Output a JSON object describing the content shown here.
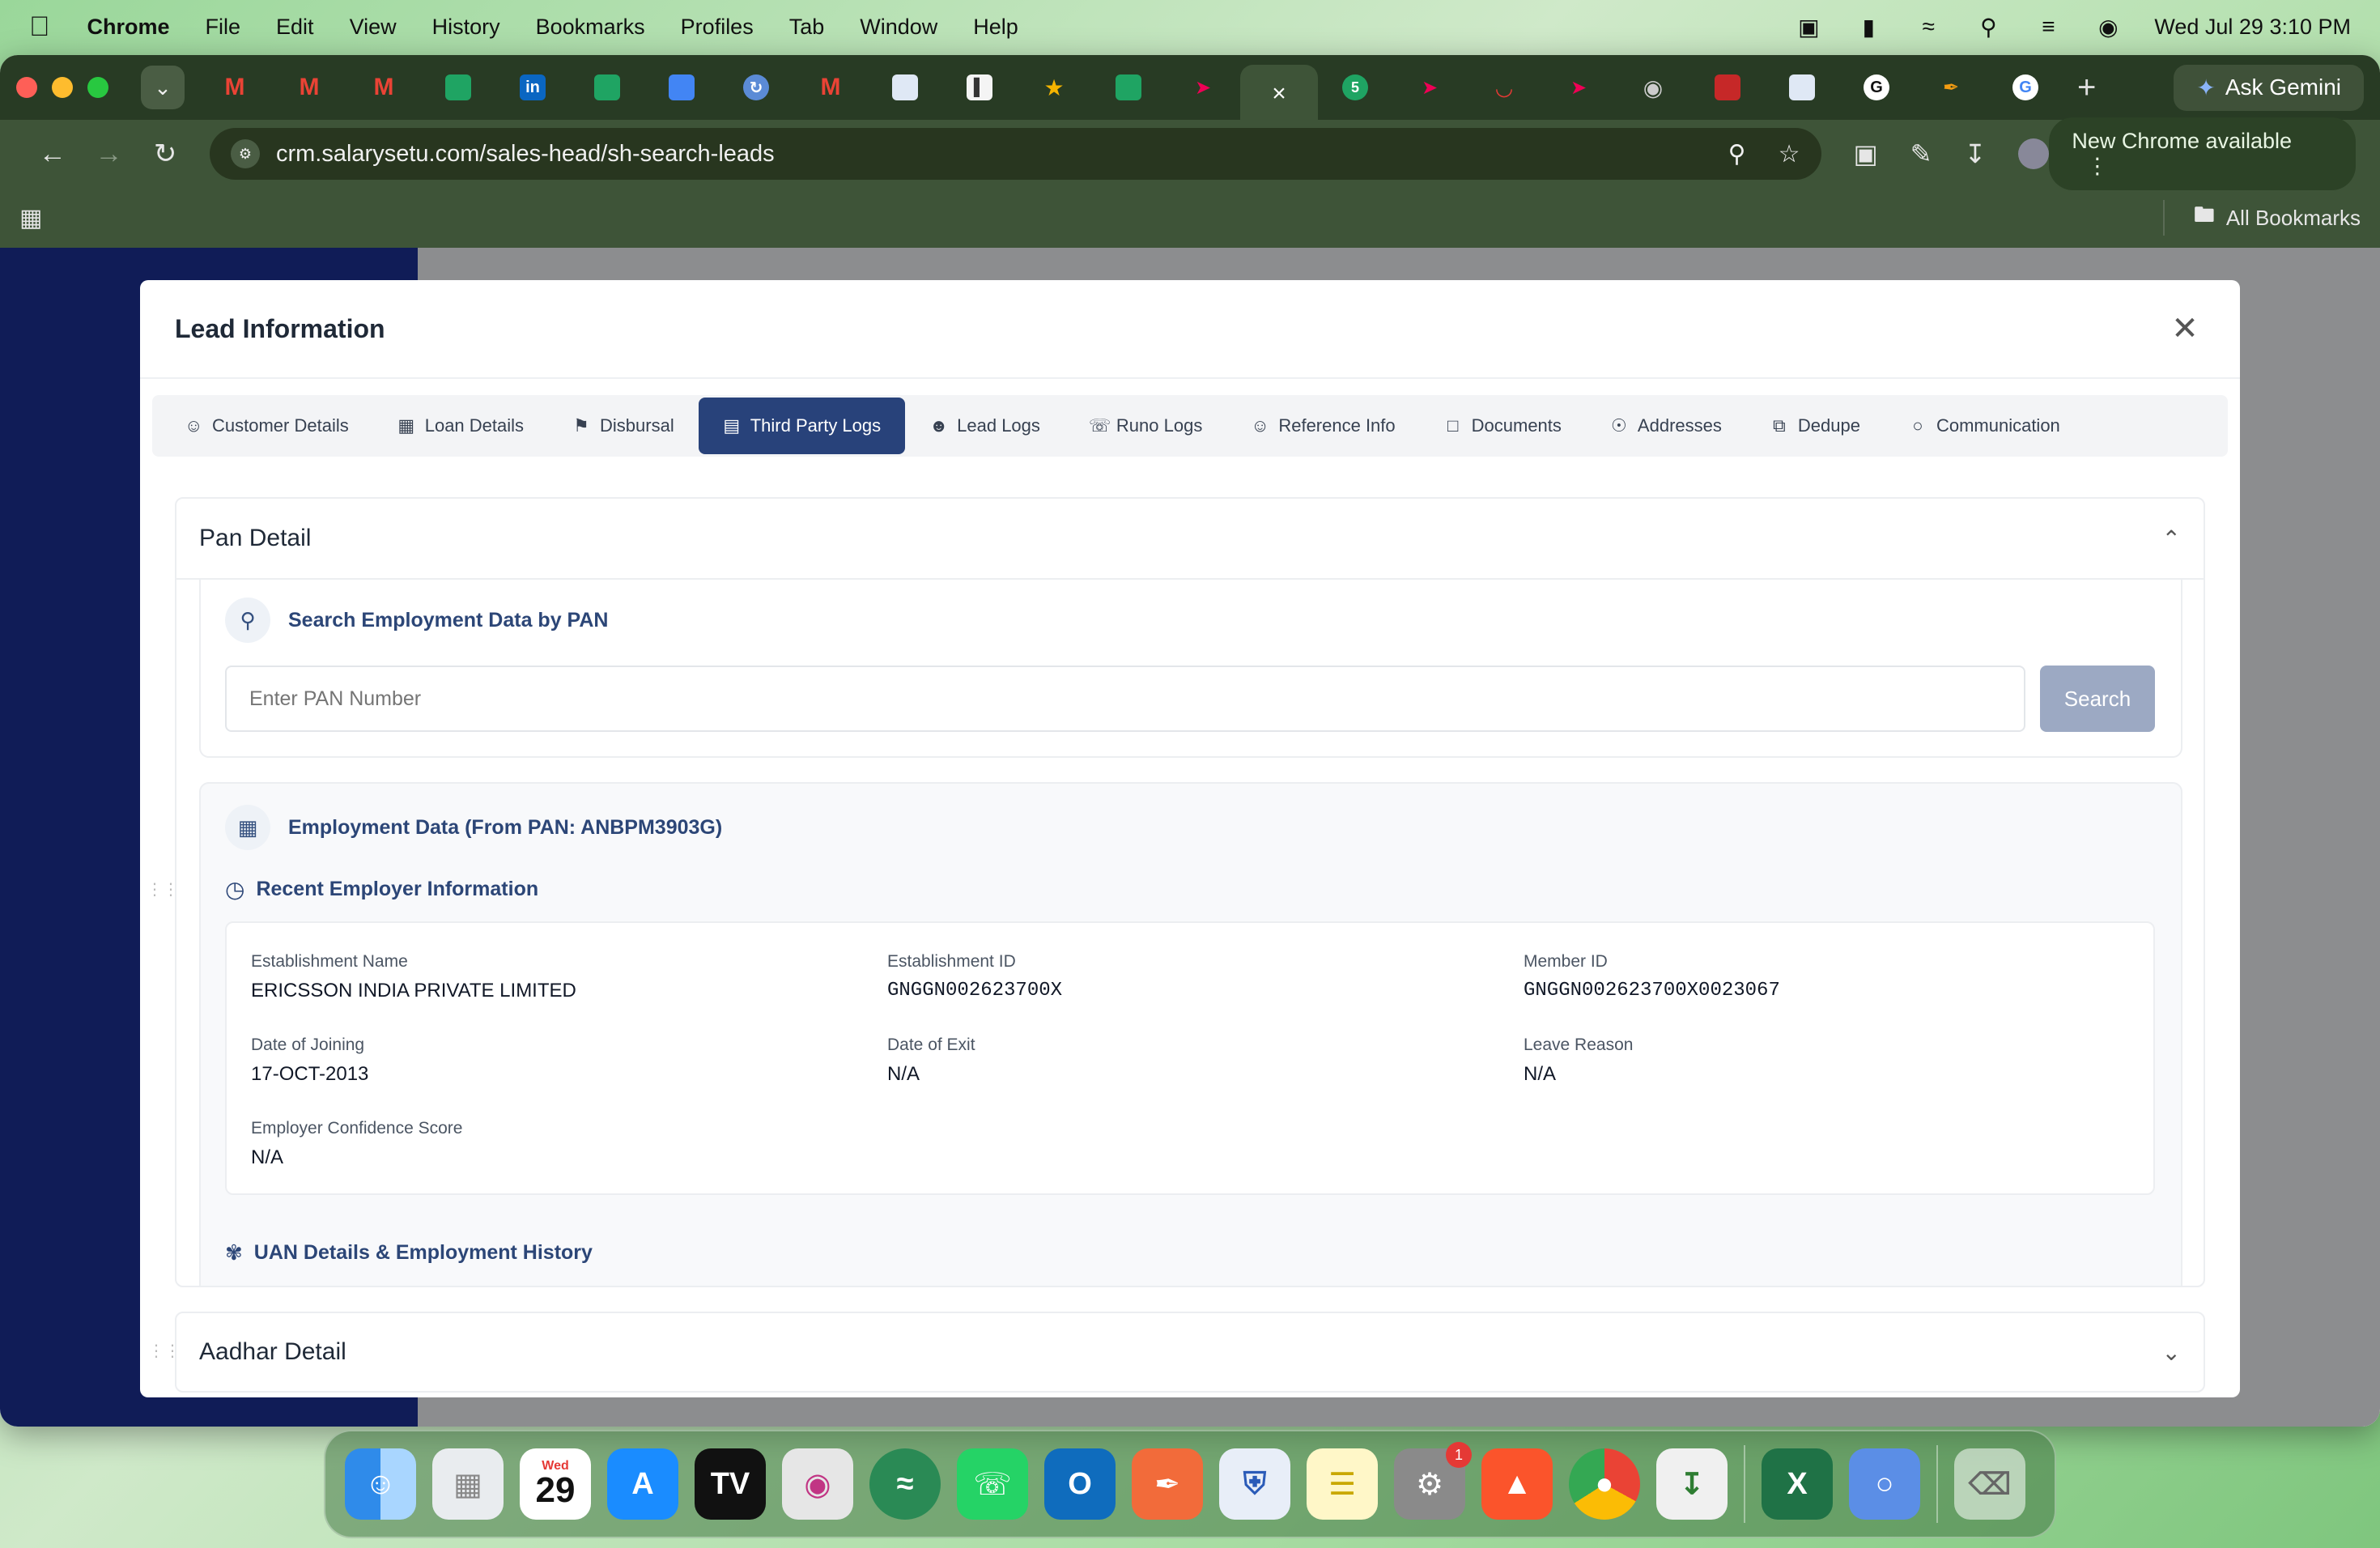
{
  "menubar": {
    "app": "Chrome",
    "items": [
      "File",
      "Edit",
      "View",
      "History",
      "Bookmarks",
      "Profiles",
      "Tab",
      "Window",
      "Help"
    ],
    "clock": "Wed Jul 29  3:10 PM"
  },
  "browser": {
    "ask_gemini": "Ask Gemini",
    "url": "crm.salarysetu.com/sales-head/sh-search-leads",
    "new_chrome": "New Chrome available",
    "all_bookmarks": "All Bookmarks"
  },
  "modal": {
    "title": "Lead Information",
    "tabs": [
      {
        "label": "Customer Details",
        "icon": "user-icon"
      },
      {
        "label": "Loan Details",
        "icon": "calculator-icon"
      },
      {
        "label": "Disbursal",
        "icon": "bank-icon"
      },
      {
        "label": "Third Party Logs",
        "icon": "document-icon"
      },
      {
        "label": "Lead Logs",
        "icon": "users-icon"
      },
      {
        "label": "Runo Logs",
        "icon": "phone-icon"
      },
      {
        "label": "Reference Info",
        "icon": "user-plus-icon"
      },
      {
        "label": "Documents",
        "icon": "file-icon"
      },
      {
        "label": "Addresses",
        "icon": "map-pin-icon"
      },
      {
        "label": "Dedupe",
        "icon": "copy-icon"
      },
      {
        "label": "Communication",
        "icon": "chat-icon"
      }
    ],
    "active_tab": "Third Party Logs"
  },
  "pan_detail": {
    "title": "Pan Detail",
    "search_title": "Search Employment Data by PAN",
    "input_placeholder": "Enter PAN Number",
    "search_button": "Search",
    "employment_title": "Employment Data (From PAN: ANBPM3903G)",
    "recent_title": "Recent Employer Information",
    "fields": {
      "establishment_name_label": "Establishment Name",
      "establishment_name": "ERICSSON INDIA PRIVATE LIMITED",
      "establishment_id_label": "Establishment ID",
      "establishment_id": "GNGGN002623700X",
      "member_id_label": "Member ID",
      "member_id": "GNGGN002623700X0023067",
      "doj_label": "Date of Joining",
      "doj": "17-OCT-2013",
      "doe_label": "Date of Exit",
      "doe": "N/A",
      "leave_label": "Leave Reason",
      "leave": "N/A",
      "score_label": "Employer Confidence Score",
      "score": "N/A"
    },
    "uan_title": "UAN Details & Employment History"
  },
  "aadhar_detail": {
    "title": "Aadhar Detail"
  },
  "dock": {
    "calendar_month": "Wed",
    "calendar_day": "29",
    "settings_badge": "1"
  }
}
